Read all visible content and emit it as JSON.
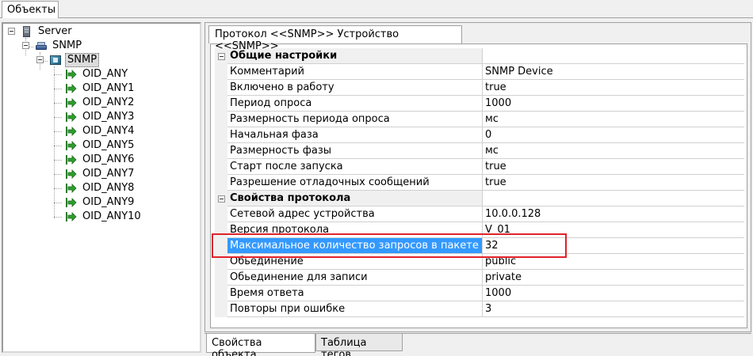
{
  "top_tab": {
    "label": "Объекты"
  },
  "tree": {
    "server": "Server",
    "network": "SNMP",
    "device": "SNMP",
    "tags": [
      "OID_ANY",
      "OID_ANY1",
      "OID_ANY2",
      "OID_ANY3",
      "OID_ANY4",
      "OID_ANY5",
      "OID_ANY6",
      "OID_ANY7",
      "OID_ANY8",
      "OID_ANY9",
      "OID_ANY10"
    ]
  },
  "panel_tab": {
    "label": "Протокол <<SNMP>> Устройство <<SNMP>>"
  },
  "properties": {
    "general": {
      "title": "Общие настройки",
      "rows": [
        {
          "key": "Комментарий",
          "value": "SNMP Device"
        },
        {
          "key": "Включено в работу",
          "value": "true"
        },
        {
          "key": "Период опроса",
          "value": "1000"
        },
        {
          "key": "Размерность периода опроса",
          "value": "мс"
        },
        {
          "key": "Начальная фаза",
          "value": "0"
        },
        {
          "key": "Размерность фазы",
          "value": "мс"
        },
        {
          "key": "Старт после запуска",
          "value": "true"
        },
        {
          "key": "Разрешение отладочных сообщений",
          "value": "true"
        }
      ]
    },
    "protocol": {
      "title": "Свойства протокола",
      "rows": [
        {
          "key": "Сетевой адрес устройства",
          "value": "10.0.0.128"
        },
        {
          "key": "Версия протокола",
          "value": "V_01"
        },
        {
          "key": "Максимальное количество запросов в пакете",
          "value": "32"
        },
        {
          "key": "Обьединение",
          "value": "public"
        },
        {
          "key": "Обьединение для записи",
          "value": "private"
        },
        {
          "key": "Время ответа",
          "value": "1000"
        },
        {
          "key": "Повторы при ошибке",
          "value": "3"
        }
      ]
    }
  },
  "bottom_tabs": {
    "object_properties": "Свойства объекта",
    "tag_table": "Таблица тегов"
  },
  "colors": {
    "selection": "#3399ff",
    "highlight_box": "#e0222a",
    "tag_arrow": "#2e9e2e"
  }
}
